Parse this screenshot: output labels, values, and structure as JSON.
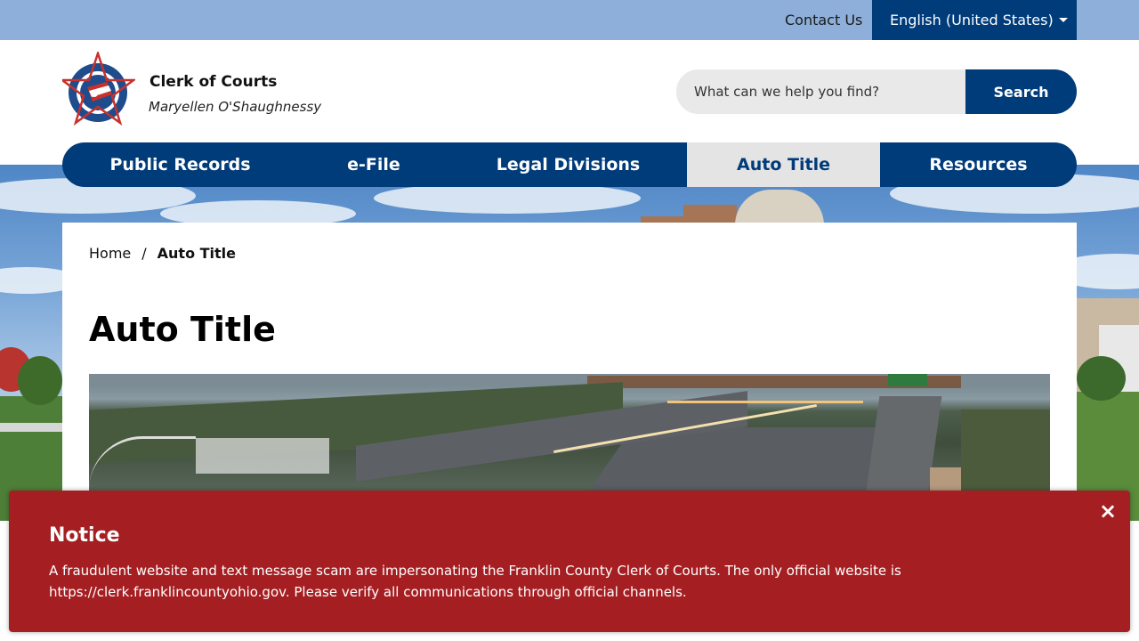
{
  "utility": {
    "contact_label": "Contact Us",
    "language_label": "English (United States)"
  },
  "header": {
    "title": "Clerk of Courts",
    "subtitle": "Maryellen O'Shaughnessy",
    "logo_icon": "star-seal-icon"
  },
  "search": {
    "placeholder": "What can we help you find?",
    "button_label": "Search"
  },
  "nav": {
    "items": [
      {
        "label": "Public Records"
      },
      {
        "label": "e-File"
      },
      {
        "label": "Legal Divisions"
      },
      {
        "label": "Auto Title",
        "active": true
      },
      {
        "label": "Resources"
      }
    ]
  },
  "breadcrumb": {
    "home": "Home",
    "separator": "/",
    "current": "Auto Title"
  },
  "page": {
    "title": "Auto Title"
  },
  "notice": {
    "title": "Notice",
    "text": "A fraudulent website and text message scam are impersonating the Franklin County Clerk of Courts. The only official website is https://clerk.franklincountyohio.gov. Please verify all communications through official channels.",
    "close_glyph": "×"
  },
  "colors": {
    "brand_blue": "#003b7a",
    "utility_bar": "#8eafd9",
    "nav_active_bg": "#e4e4e4",
    "notice_red": "#a51f22"
  }
}
